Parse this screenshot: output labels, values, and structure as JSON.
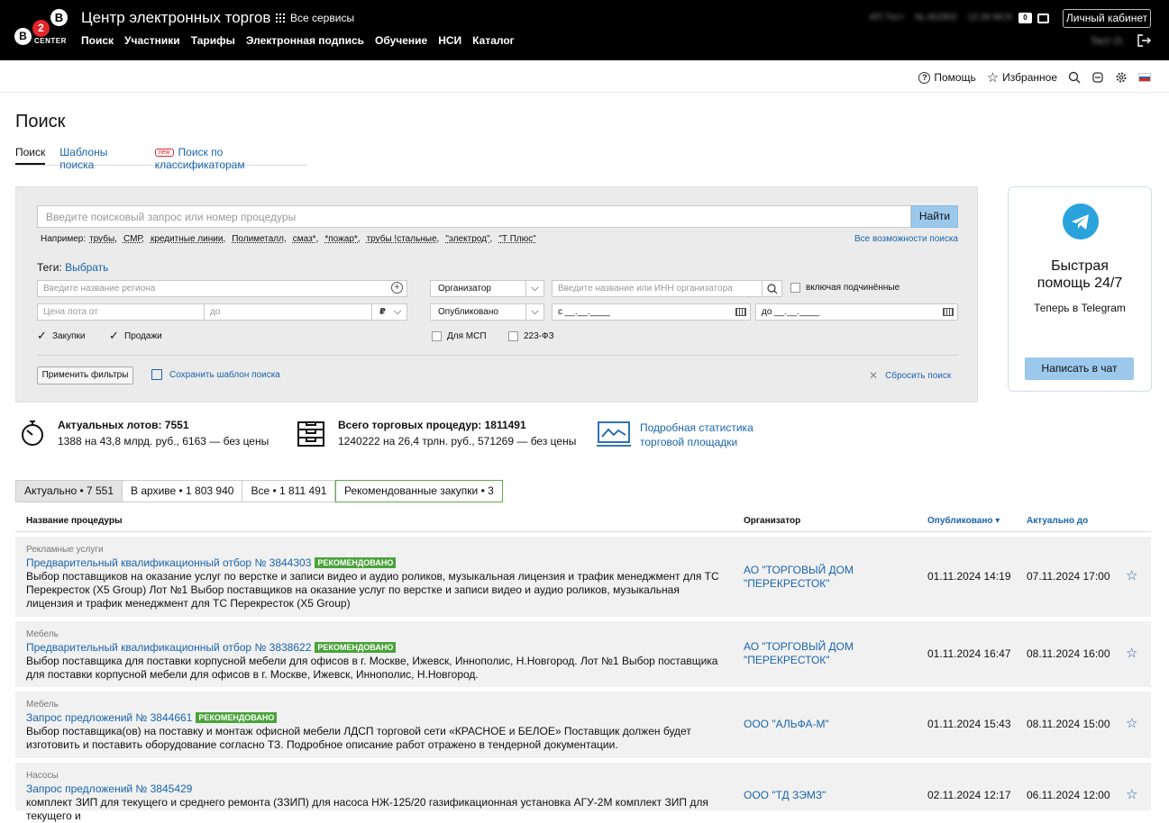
{
  "header": {
    "site_title": "Центр электронных торгов",
    "all_services": "Все сервисы",
    "nav": [
      "Поиск",
      "Участники",
      "Тарифы",
      "Электронная подпись",
      "Обучение",
      "НСИ",
      "Каталог"
    ],
    "user_blurred": [
      "ИП Тест",
      "№ 452902",
      "12:28 МСК"
    ],
    "messages_count": "0",
    "cabinet": "Личный кабинет",
    "user_name": "Тест О."
  },
  "utility": {
    "help": "Помощь",
    "favorites": "Избранное"
  },
  "page": {
    "title": "Поиск",
    "tabs": [
      {
        "label": "Поиск"
      },
      {
        "label": "Шаблоны поиска"
      },
      {
        "badge": "new",
        "label": "Поиск по классификаторам"
      }
    ]
  },
  "search": {
    "placeholder": "Введите поисковый запрос или номер процедуры",
    "button": "Найти",
    "examples_label": "Например:",
    "examples": [
      "трубы,",
      "СМР,",
      "кредитные линии,",
      "Полиметалл,",
      "смаз*,",
      "*пожар*,",
      "трубы !стальные,",
      "\"электрод\",",
      "\"Т Плюс\""
    ],
    "all_features": "Все возможности поиска",
    "tags_label": "Теги:",
    "tags_link": "Выбрать",
    "region_placeholder": "Введите название региона",
    "price_from": "Цена лота от",
    "price_to": "до",
    "currency": "₽",
    "purchases": "Закупки",
    "sales": "Продажи",
    "organizer_select": "Организатор",
    "organizer_placeholder": "Введите название или ИНН организатора",
    "include_sub": "включая подчинённые",
    "published_select": "Опубликовано",
    "date_from": "с   __.__.____",
    "date_to": "до   __.__.____",
    "msp": "Для МСП",
    "fz223": "223-ФЗ",
    "apply": "Применить фильтры",
    "save_template": "Сохранить шаблон поиска",
    "reset": "Сбросить поиск"
  },
  "help_card": {
    "title": "Быстрая помощь 24/7",
    "subtitle": "Теперь в Telegram",
    "button": "Написать в чат"
  },
  "stats": {
    "lots_title": "Актуальных лотов: 7551",
    "lots_sub": "1388 на 43,8 млрд. руб., 6163 — без цены",
    "procedures_title": "Всего торговых процедур: 1811491",
    "procedures_sub": "1240222 на 26,4 трлн. руб., 571269 — без цены",
    "stat_link_1": "Подробная статистика",
    "stat_link_2": "торговой площадки"
  },
  "result_tabs": {
    "actual": "Актуально • 7 551",
    "archive": "В архиве • 1 803 940",
    "all": "Все • 1 811 491",
    "recommended": "Рекомендованные закупки • 3"
  },
  "table": {
    "col_name": "Название процедуры",
    "col_org": "Организатор",
    "col_published": "Опубликовано ▾",
    "col_actual": "Актуально до",
    "rows": [
      {
        "category": "Рекламные услуги",
        "title": "Предварительный квалификационный отбор № 3844303",
        "badge": "РЕКОМЕНДОВАНО",
        "desc": "Выбор поставщиков на оказание услуг по верстке и записи видео и аудио роликов, музыкальная лицензия и трафик менеджмент для ТС Перекресток (X5 Group) Лот №1 Выбор поставщиков на оказание услуг по верстке и записи видео и аудио роликов, музыкальная лицензия и трафик менеджмент для ТС Перекресток (X5 Group)",
        "org": "АО \"ТОРГОВЫЙ ДОМ \"ПЕРЕКРЕСТОК\"",
        "published": "01.11.2024 14:19",
        "actual": "07.11.2024 17:00"
      },
      {
        "category": "Мебель",
        "title": "Предварительный квалификационный отбор № 3838622",
        "badge": "РЕКОМЕНДОВАНО",
        "desc": "Выбор поставщика для поставки корпусной мебели для офисов в г. Москве, Ижевск, Иннополис, Н.Новгород. Лот №1 Выбор поставщика для поставки корпусной мебели для офисов в г. Москве, Ижевск, Иннополис, Н.Новгород.",
        "org": "АО \"ТОРГОВЫЙ ДОМ \"ПЕРЕКРЕСТОК\"",
        "published": "01.11.2024 16:47",
        "actual": "08.11.2024 16:00"
      },
      {
        "category": "Мебель",
        "title": "Запрос предложений № 3844661",
        "badge": "РЕКОМЕНДОВАНО",
        "desc": "Выбор поставщика(ов) на поставку и монтаж офисной мебели ЛДСП торговой сети «КРАСНОЕ и БЕЛОЕ» Поставщик должен будет изготовить и поставить оборудование согласно ТЗ. Подробное описание работ отражено в тендерной документации.",
        "org": "ООО \"АЛЬФА-М\"",
        "published": "01.11.2024 15:43",
        "actual": "08.11.2024 15:00"
      },
      {
        "category": "Насосы",
        "title": "Запрос предложений № 3845429",
        "badge": "",
        "desc": "комплект ЗИП для текущего и среднего ремонта (ЗЗИП) для насоса НЖ-125/20 газификационная установка АГУ-2М комплект ЗИП для текущего и",
        "org": "ООО \"ТД ЗЭМЗ\"",
        "published": "02.11.2024 12:17",
        "actual": "06.11.2024 12:00"
      }
    ]
  },
  "colors": {
    "accent": "#1a64ad",
    "recommended": "#4aa33a",
    "button": "#9cc8ec",
    "header": "#000000"
  }
}
